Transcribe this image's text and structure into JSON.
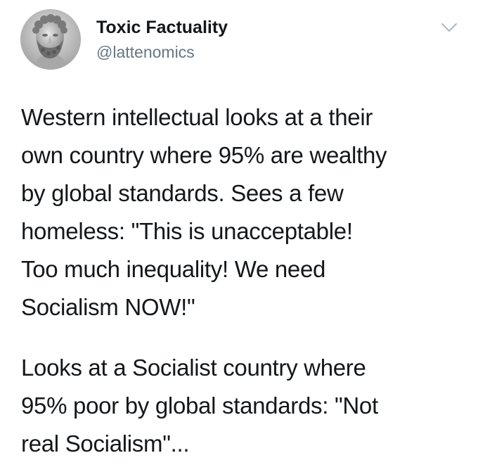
{
  "author": {
    "display_name": "Toxic Factuality",
    "handle": "@lattenomics",
    "avatar_icon": "marble-bust-avatar"
  },
  "menu_icon": "chevron-down-icon",
  "tweet": {
    "paragraph_1": [
      "Western intellectual looks at a their",
      "own country where 95% are wealthy",
      "by global standards. Sees a few",
      "homeless: \"This is unacceptable!",
      "Too much inequality! We need",
      "Socialism NOW!\""
    ],
    "paragraph_2": [
      "Looks at a Socialist country where",
      "95% poor by global standards: \"Not",
      "real Socialism\"..."
    ]
  },
  "colors": {
    "text": "#14171a",
    "secondary": "#657786",
    "background": "#ffffff"
  }
}
